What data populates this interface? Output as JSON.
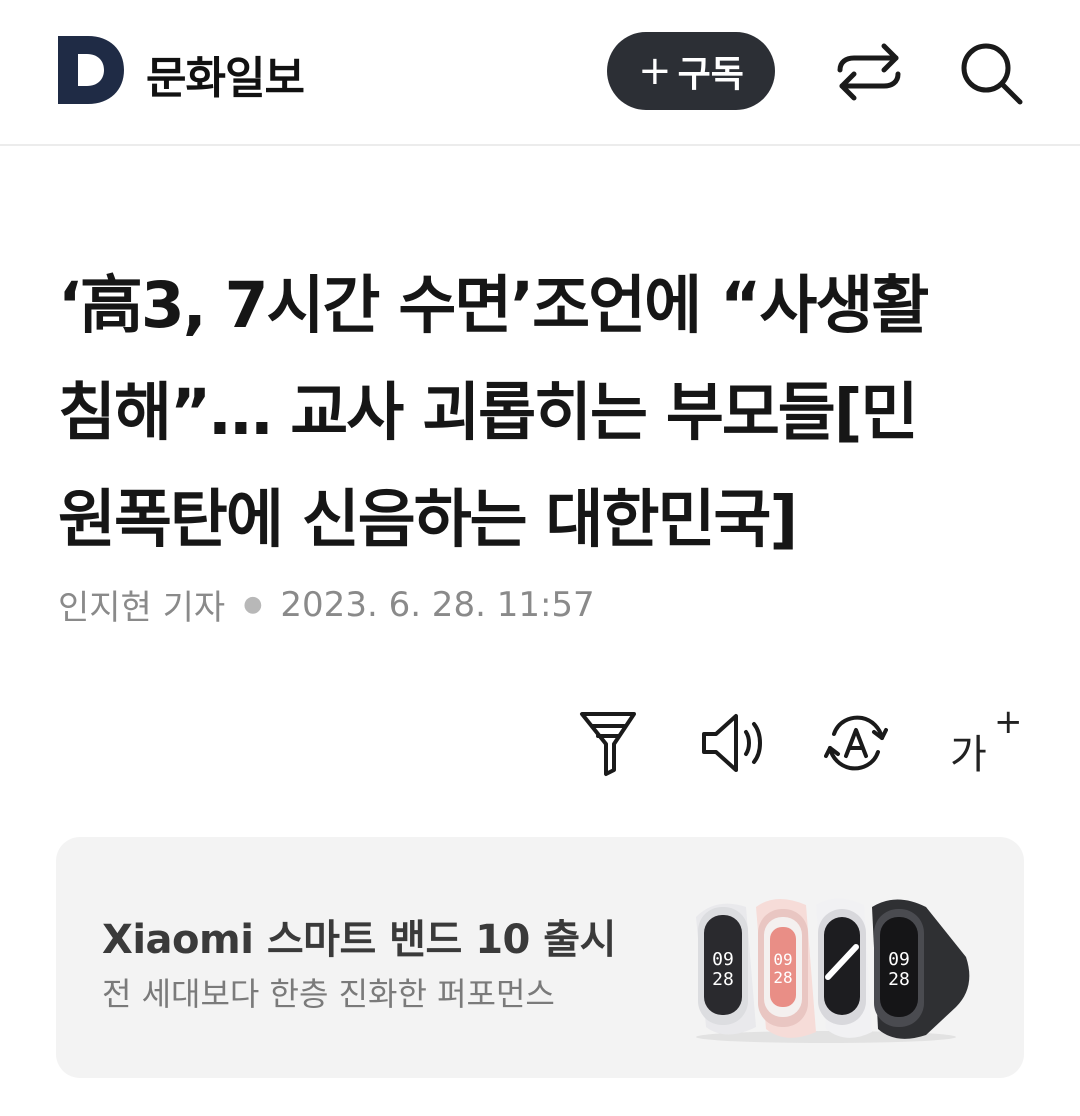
{
  "header": {
    "logo_letter": "D",
    "publisher": "문화일보",
    "subscribe_plus": "+",
    "subscribe_label": "구독"
  },
  "article": {
    "headline_lines": [
      "‘高3, 7시간 수면’조언에 “사생활",
      "침해”… 교사 괴롭히는 부모들[민",
      "원폭탄에 신음하는 대한민국]"
    ],
    "author": "인지현 기자",
    "date": "2023. 6. 28. 11:57"
  },
  "toolbar": {
    "font_size_label": "가",
    "font_size_plus": "+",
    "icons": [
      "filter-icon",
      "speaker-icon",
      "translate-icon",
      "font-size-icon"
    ]
  },
  "ad": {
    "title": "Xiaomi 스마트 밴드 10 출시",
    "subtitle": "전 세대보다 한층 진화한 퍼포먼스",
    "watch_time_a": "09",
    "watch_time_b": "28"
  },
  "colors": {
    "logo_navy": "#1f2b45",
    "subscribe_bg": "#2c2f35",
    "banner_bg": "#f3f3f3"
  }
}
